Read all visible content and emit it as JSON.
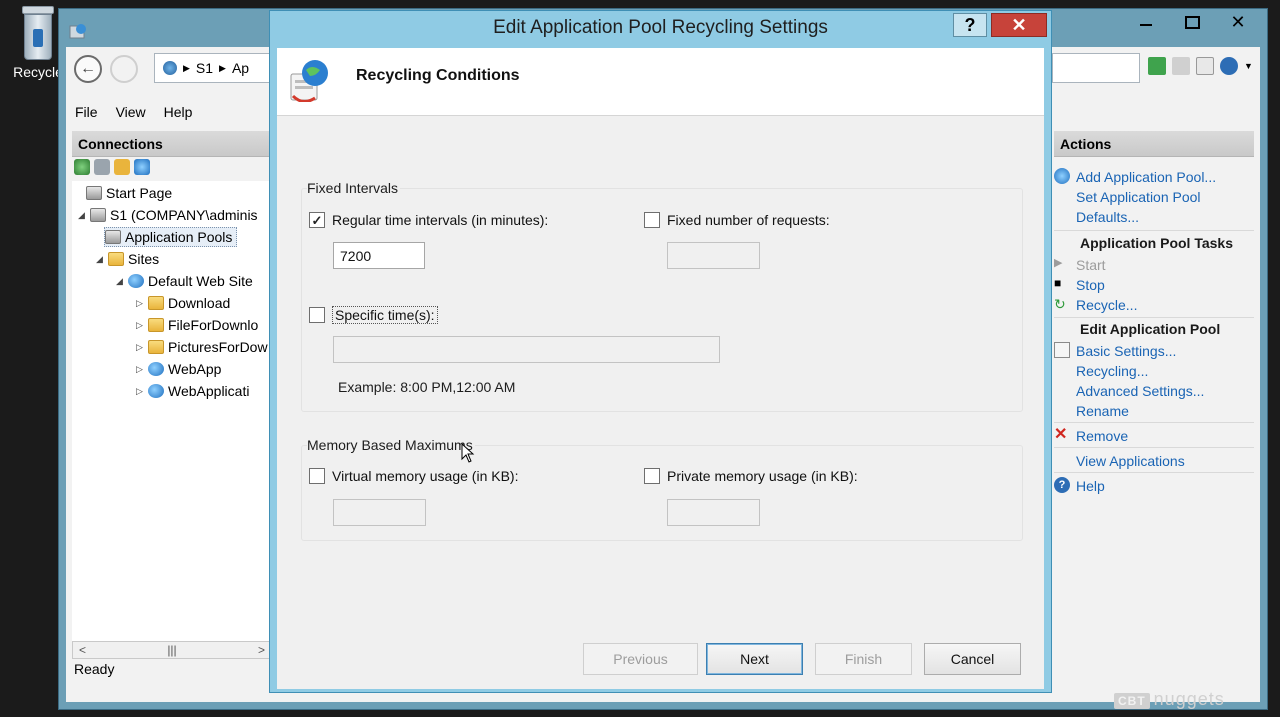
{
  "desktop": {
    "recycle_label": "Recycle"
  },
  "iis": {
    "address": {
      "crumb1": "S1",
      "crumb2": "Ap"
    },
    "menu": {
      "file": "File",
      "view": "View",
      "help": "Help"
    },
    "connections": {
      "title": "Connections",
      "tree": {
        "start_page": "Start Page",
        "server": "S1 (COMPANY\\adminis",
        "app_pools": "Application Pools",
        "sites": "Sites",
        "default_site": "Default Web Site",
        "download": "Download",
        "file_for_download": "FileForDownlo",
        "pictures": "PicturesForDow",
        "webapp": "WebApp",
        "webapplication": "WebApplicati"
      }
    },
    "status": "Ready",
    "actions": {
      "title": "Actions",
      "add_pool": "Add Application Pool...",
      "set_defaults_1": "Set Application Pool",
      "set_defaults_2": "Defaults...",
      "tasks_title": "Application Pool Tasks",
      "start": "Start",
      "stop": "Stop",
      "recycle": "Recycle...",
      "edit_title": "Edit Application Pool",
      "basic_settings": "Basic Settings...",
      "recycling": "Recycling...",
      "advanced_settings": "Advanced Settings...",
      "rename": "Rename",
      "remove": "Remove",
      "view_apps": "View Applications",
      "help": "Help"
    },
    "watermark": {
      "badge": "CBT",
      "text": "nuggets"
    }
  },
  "dialog": {
    "title": "Edit Application Pool Recycling Settings",
    "help_glyph": "?",
    "close_glyph": "✕",
    "banner_title": "Recycling Conditions",
    "fixed_intervals": {
      "label": "Fixed Intervals",
      "regular_time_label": "Regular time intervals (in minutes):",
      "regular_time_checked": true,
      "regular_time_value": "7200",
      "fixed_requests_label": "Fixed number of requests:",
      "fixed_requests_checked": false,
      "fixed_requests_value": "",
      "specific_times_label": "Specific time(s):",
      "specific_times_checked": false,
      "specific_times_value": "",
      "example": "Example: 8:00 PM,12:00 AM"
    },
    "memory": {
      "label": "Memory Based Maximums",
      "virtual_label": "Virtual memory usage (in KB):",
      "virtual_checked": false,
      "virtual_value": "",
      "private_label": "Private memory usage (in KB):",
      "private_checked": false,
      "private_value": ""
    },
    "buttons": {
      "previous": "Previous",
      "next": "Next",
      "finish": "Finish",
      "cancel": "Cancel"
    },
    "check_glyph": "✓"
  }
}
